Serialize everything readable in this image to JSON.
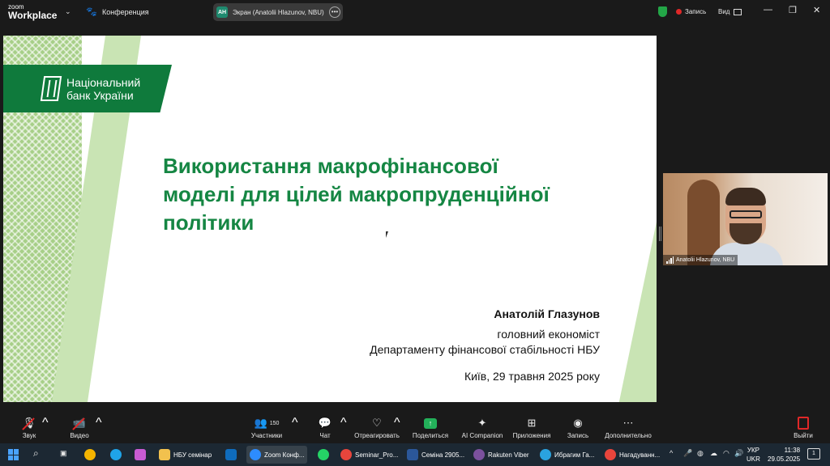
{
  "app": {
    "logo_line1": "zoom",
    "logo_line2": "Workplace",
    "meeting_label": "Конференция",
    "share_pill": {
      "initials": "AH",
      "text": "Экран (Anatolii Hlazunov, NBU)"
    },
    "record_label": "Запись",
    "view_label": "Вид"
  },
  "slide": {
    "bank_name_line1": "Національний",
    "bank_name_line2": "банк України",
    "title_line1": "Використання макрофінансової",
    "title_line2": "моделі для цілей макропруденційної",
    "title_line3": "політики",
    "author": "Анатолій Глазунов",
    "role": "головний економіст",
    "department": "Департаменту фінансової стабільності НБУ",
    "place_date": "Київ, 29 травня 2025 року"
  },
  "video": {
    "participant_name": "Anatolii Hlazunov, NBU"
  },
  "toolbar": {
    "audio": "Звук",
    "video": "Видео",
    "participants": "Участники",
    "participants_count": "150",
    "chat": "Чат",
    "react": "Отреагировать",
    "share": "Поделиться",
    "ai": "AI Companion",
    "apps": "Приложения",
    "record": "Запись",
    "more": "Дополнительно",
    "leave": "Выйти"
  },
  "taskbar": {
    "items": [
      {
        "label": "НБУ семінар",
        "color": "#f2c14e"
      },
      {
        "label": "Zoom Конф...",
        "color": "#2d8cff"
      },
      {
        "label": "Seminar_Pro...",
        "color": "#e8453c"
      },
      {
        "label": "Семіна 2905...",
        "color": "#2b579a"
      },
      {
        "label": "Rakuten Viber",
        "color": "#7b519d"
      },
      {
        "label": "Ибрагим Га...",
        "color": "#2aa3df"
      },
      {
        "label": "Нагадуванн...",
        "color": "#e8453c"
      }
    ],
    "lang_line1": "УКР",
    "lang_line2": "UKR",
    "time": "11:38",
    "date": "29.05.2025",
    "notifications": "1"
  }
}
